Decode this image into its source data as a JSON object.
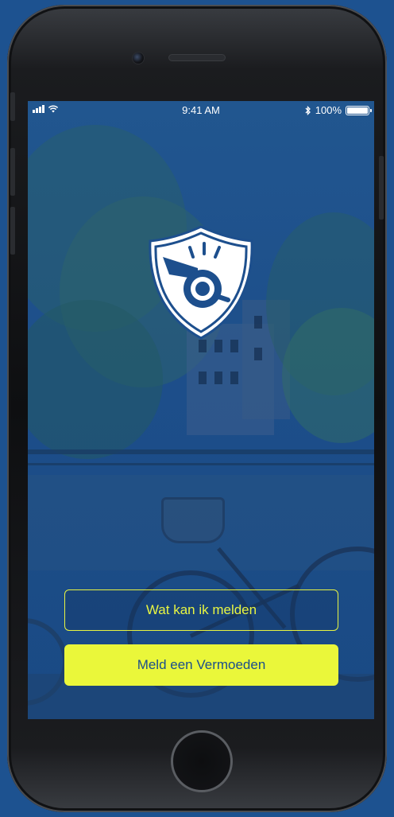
{
  "status_bar": {
    "time": "9:41 AM",
    "battery_text": "100%",
    "signal_icon": "signal-icon",
    "wifi_icon": "wifi-icon",
    "bluetooth_icon": "bluetooth-icon",
    "battery_icon": "battery-icon",
    "battery_level": 1.0
  },
  "logo": {
    "icon": "whistle-shield-icon"
  },
  "actions": {
    "secondary_label": "Wat kan ik melden",
    "primary_label": "Meld een Vermoeden"
  },
  "colors": {
    "brand_blue": "#1d4f8d",
    "accent_yellow": "#eaf73a",
    "outline_yellow": "#e8f542",
    "logo_white": "#ffffff"
  }
}
